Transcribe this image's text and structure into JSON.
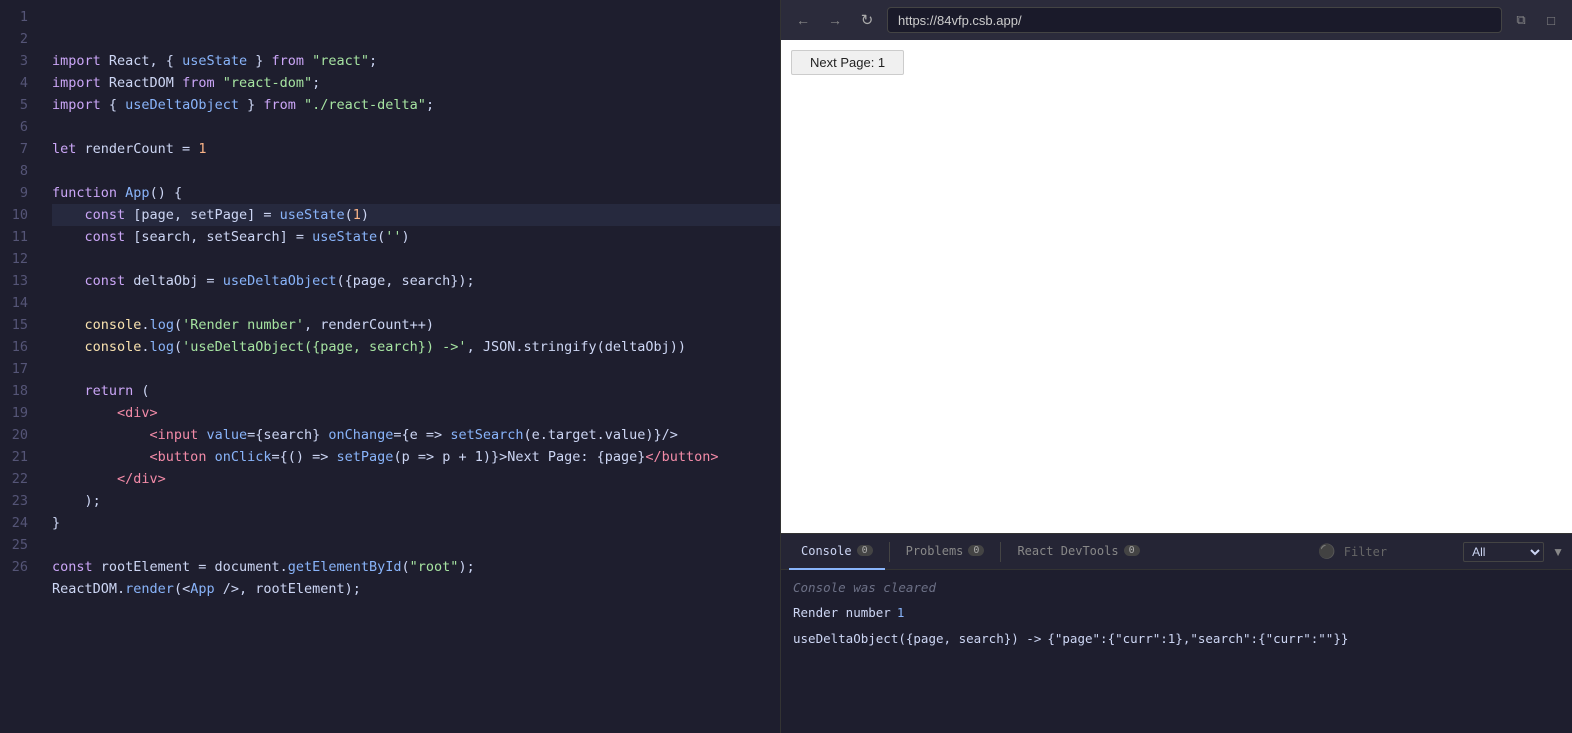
{
  "editor": {
    "lines": [
      {
        "num": 1,
        "tokens": [
          {
            "t": "kw",
            "v": "import"
          },
          {
            "t": "plain",
            "v": " React, { "
          },
          {
            "t": "fn",
            "v": "useState"
          },
          {
            "t": "plain",
            "v": " } "
          },
          {
            "t": "kw",
            "v": "from"
          },
          {
            "t": "plain",
            "v": " "
          },
          {
            "t": "str",
            "v": "\"react\""
          },
          {
            "t": "plain",
            "v": ";"
          }
        ]
      },
      {
        "num": 2,
        "tokens": [
          {
            "t": "kw",
            "v": "import"
          },
          {
            "t": "plain",
            "v": " ReactDOM "
          },
          {
            "t": "kw",
            "v": "from"
          },
          {
            "t": "plain",
            "v": " "
          },
          {
            "t": "str",
            "v": "\"react-dom\""
          },
          {
            "t": "plain",
            "v": ";"
          }
        ]
      },
      {
        "num": 3,
        "tokens": [
          {
            "t": "kw",
            "v": "import"
          },
          {
            "t": "plain",
            "v": " { "
          },
          {
            "t": "fn",
            "v": "useDeltaObject"
          },
          {
            "t": "plain",
            "v": " } "
          },
          {
            "t": "kw",
            "v": "from"
          },
          {
            "t": "plain",
            "v": " "
          },
          {
            "t": "str",
            "v": "\"./react-delta\""
          },
          {
            "t": "plain",
            "v": ";"
          }
        ]
      },
      {
        "num": 4,
        "tokens": []
      },
      {
        "num": 5,
        "tokens": [
          {
            "t": "kw",
            "v": "let"
          },
          {
            "t": "plain",
            "v": " renderCount = "
          },
          {
            "t": "num",
            "v": "1"
          }
        ]
      },
      {
        "num": 6,
        "tokens": []
      },
      {
        "num": 7,
        "tokens": [
          {
            "t": "kw",
            "v": "function"
          },
          {
            "t": "plain",
            "v": " "
          },
          {
            "t": "fn",
            "v": "App"
          },
          {
            "t": "plain",
            "v": "() {"
          }
        ]
      },
      {
        "num": 8,
        "tokens": [
          {
            "t": "plain",
            "v": "    "
          },
          {
            "t": "kw",
            "v": "const"
          },
          {
            "t": "plain",
            "v": " [page, setPage] = "
          },
          {
            "t": "fn",
            "v": "useState"
          },
          {
            "t": "plain",
            "v": "("
          },
          {
            "t": "num",
            "v": "1"
          },
          {
            "t": "plain",
            "v": ")"
          }
        ],
        "highlight": true
      },
      {
        "num": 9,
        "tokens": [
          {
            "t": "plain",
            "v": "    "
          },
          {
            "t": "kw",
            "v": "const"
          },
          {
            "t": "plain",
            "v": " [search, setSearch] = "
          },
          {
            "t": "fn",
            "v": "useState"
          },
          {
            "t": "plain",
            "v": "("
          },
          {
            "t": "str",
            "v": "''"
          },
          {
            "t": "plain",
            "v": ")"
          }
        ]
      },
      {
        "num": 10,
        "tokens": []
      },
      {
        "num": 11,
        "tokens": [
          {
            "t": "plain",
            "v": "    "
          },
          {
            "t": "kw",
            "v": "const"
          },
          {
            "t": "plain",
            "v": " deltaObj = "
          },
          {
            "t": "fn",
            "v": "useDeltaObject"
          },
          {
            "t": "plain",
            "v": "({page, search});"
          }
        ]
      },
      {
        "num": 12,
        "tokens": []
      },
      {
        "num": 13,
        "tokens": [
          {
            "t": "plain",
            "v": "    "
          },
          {
            "t": "obj",
            "v": "console"
          },
          {
            "t": "plain",
            "v": "."
          },
          {
            "t": "method",
            "v": "log"
          },
          {
            "t": "plain",
            "v": "("
          },
          {
            "t": "str",
            "v": "'Render number'"
          },
          {
            "t": "plain",
            "v": ", renderCount++)"
          }
        ]
      },
      {
        "num": 14,
        "tokens": [
          {
            "t": "plain",
            "v": "    "
          },
          {
            "t": "obj",
            "v": "console"
          },
          {
            "t": "plain",
            "v": "."
          },
          {
            "t": "method",
            "v": "log"
          },
          {
            "t": "plain",
            "v": "("
          },
          {
            "t": "str",
            "v": "'useDeltaObject({page, search}) ->'"
          },
          {
            "t": "plain",
            "v": ", JSON.stringify(deltaObj))"
          }
        ]
      },
      {
        "num": 15,
        "tokens": []
      },
      {
        "num": 16,
        "tokens": [
          {
            "t": "plain",
            "v": "    "
          },
          {
            "t": "kw",
            "v": "return"
          },
          {
            "t": "plain",
            "v": " ("
          }
        ]
      },
      {
        "num": 17,
        "tokens": [
          {
            "t": "plain",
            "v": "        "
          },
          {
            "t": "tag",
            "v": "<div>"
          }
        ]
      },
      {
        "num": 18,
        "tokens": [
          {
            "t": "plain",
            "v": "            "
          },
          {
            "t": "tag",
            "v": "<input"
          },
          {
            "t": "plain",
            "v": " "
          },
          {
            "t": "attr",
            "v": "value"
          },
          {
            "t": "plain",
            "v": "={search} "
          },
          {
            "t": "attr",
            "v": "onChange"
          },
          {
            "t": "plain",
            "v": "={e => "
          },
          {
            "t": "fn",
            "v": "setSearch"
          },
          {
            "t": "plain",
            "v": "(e.target.value)}/>"
          }
        ]
      },
      {
        "num": 19,
        "tokens": [
          {
            "t": "plain",
            "v": "            "
          },
          {
            "t": "tag",
            "v": "<button"
          },
          {
            "t": "plain",
            "v": " "
          },
          {
            "t": "attr",
            "v": "onClick"
          },
          {
            "t": "plain",
            "v": "={() => "
          },
          {
            "t": "fn",
            "v": "setPage"
          },
          {
            "t": "plain",
            "v": "(p => p + 1)}>Next Page: {page}"
          },
          {
            "t": "tag",
            "v": "</button>"
          }
        ]
      },
      {
        "num": 20,
        "tokens": [
          {
            "t": "plain",
            "v": "        "
          },
          {
            "t": "tag",
            "v": "</div>"
          }
        ]
      },
      {
        "num": 21,
        "tokens": [
          {
            "t": "plain",
            "v": "    );"
          }
        ]
      },
      {
        "num": 22,
        "tokens": [
          {
            "t": "plain",
            "v": "}"
          }
        ]
      },
      {
        "num": 23,
        "tokens": []
      },
      {
        "num": 24,
        "tokens": [
          {
            "t": "kw",
            "v": "const"
          },
          {
            "t": "plain",
            "v": " rootElement = document."
          },
          {
            "t": "method",
            "v": "getElementById"
          },
          {
            "t": "plain",
            "v": "("
          },
          {
            "t": "str",
            "v": "\"root\""
          },
          {
            "t": "plain",
            "v": ");"
          }
        ]
      },
      {
        "num": 25,
        "tokens": [
          {
            "t": "plain",
            "v": "ReactDOM."
          },
          {
            "t": "method",
            "v": "render"
          },
          {
            "t": "plain",
            "v": "(<"
          },
          {
            "t": "fn",
            "v": "App"
          },
          {
            "t": "plain",
            "v": " />, rootElement);"
          }
        ]
      },
      {
        "num": 26,
        "tokens": []
      }
    ]
  },
  "browser": {
    "url": "https://84vfp.csb.app/",
    "back_title": "Back",
    "forward_title": "Forward",
    "refresh_title": "Refresh",
    "next_page_button": "Next Page: 1",
    "window_icon": "⧉",
    "maximize_icon": "□"
  },
  "console": {
    "tabs": [
      {
        "label": "Console",
        "badge": "0",
        "active": true
      },
      {
        "label": "Problems",
        "badge": "0",
        "active": false
      },
      {
        "label": "React DevTools",
        "badge": "0",
        "active": false
      }
    ],
    "filter_placeholder": "Filter",
    "filter_value": "All",
    "cleared_message": "Console was cleared",
    "log_lines": [
      {
        "text": "Render number",
        "value": "1"
      },
      {
        "text": "useDeltaObject({page, search}) ->",
        "value": "  {\"page\":{\"curr\":1},\"search\":{\"curr\":\"\"}}"
      }
    ]
  }
}
